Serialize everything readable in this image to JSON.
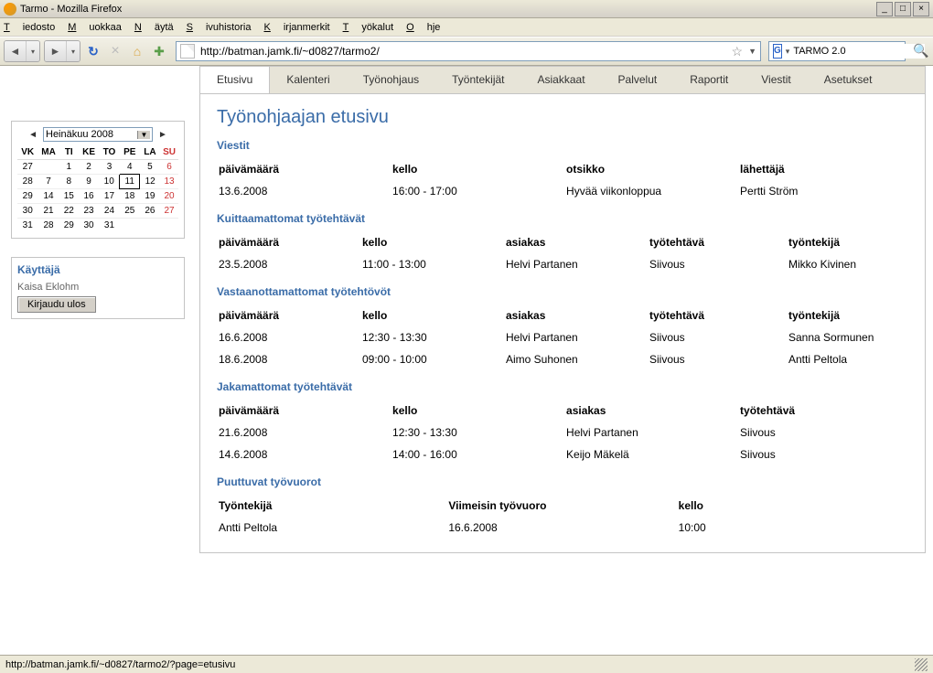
{
  "window": {
    "title": "Tarmo - Mozilla Firefox",
    "status": "http://batman.jamk.fi/~d0827/tarmo2/?page=etusivu"
  },
  "menubar": [
    "Tiedosto",
    "Muokkaa",
    "Näytä",
    "Sivuhistoria",
    "Kirjanmerkit",
    "Työkalut",
    "Ohje"
  ],
  "toolbar": {
    "url": "http://batman.jamk.fi/~d0827/tarmo2/",
    "search_value": "TARMO 2.0"
  },
  "calendar": {
    "month_label": "Heinäkuu 2008",
    "headers": [
      "VK",
      "MA",
      "TI",
      "KE",
      "TO",
      "PE",
      "LA",
      "SU"
    ],
    "rows": [
      [
        "27",
        "",
        "1",
        "2",
        "3",
        "4",
        "5",
        "6"
      ],
      [
        "28",
        "7",
        "8",
        "9",
        "10",
        "11",
        "12",
        "13"
      ],
      [
        "29",
        "14",
        "15",
        "16",
        "17",
        "18",
        "19",
        "20"
      ],
      [
        "30",
        "21",
        "22",
        "23",
        "24",
        "25",
        "26",
        "27"
      ],
      [
        "31",
        "28",
        "29",
        "30",
        "31",
        "",
        "",
        ""
      ]
    ],
    "today_cell": [
      1,
      5
    ]
  },
  "user": {
    "heading": "Käyttäjä",
    "name": "Kaisa Eklohm",
    "logout": "Kirjaudu ulos"
  },
  "tabs": [
    "Etusivu",
    "Kalenteri",
    "Työnohjaus",
    "Työntekijät",
    "Asiakkaat",
    "Palvelut",
    "Raportit",
    "Viestit",
    "Asetukset"
  ],
  "active_tab": 0,
  "page": {
    "title": "Työnohjaajan etusivu",
    "sections": {
      "viestit": {
        "title": "Viestit",
        "headers": [
          "päivämäärä",
          "kello",
          "otsikko",
          "lähettäjä"
        ],
        "rows": [
          [
            "13.6.2008",
            "16:00 - 17:00",
            "Hyvää viikonloppua",
            "Pertti Ström"
          ]
        ]
      },
      "kuittaamattomat": {
        "title": "Kuittaamattomat työtehtävät",
        "headers": [
          "päivämäärä",
          "kello",
          "asiakas",
          "työtehtävä",
          "työntekijä"
        ],
        "rows": [
          [
            "23.5.2008",
            "11:00 - 13:00",
            "Helvi Partanen",
            "Siivous",
            "Mikko Kivinen"
          ]
        ]
      },
      "vastaanottamattomat": {
        "title": "Vastaanottamattomat työtehtövöt",
        "headers": [
          "päivämäärä",
          "kello",
          "asiakas",
          "työtehtävä",
          "työntekijä"
        ],
        "rows": [
          [
            "16.6.2008",
            "12:30 - 13:30",
            "Helvi Partanen",
            "Siivous",
            "Sanna Sormunen"
          ],
          [
            "18.6.2008",
            "09:00 - 10:00",
            "Aimo Suhonen",
            "Siivous",
            "Antti Peltola"
          ]
        ]
      },
      "jakamattomat": {
        "title": "Jakamattomat työtehtävät",
        "headers": [
          "päivämäärä",
          "kello",
          "asiakas",
          "työtehtävä"
        ],
        "rows": [
          [
            "21.6.2008",
            "12:30 - 13:30",
            "Helvi Partanen",
            "Siivous"
          ],
          [
            "14.6.2008",
            "14:00 - 16:00",
            "Keijo Mäkelä",
            "Siivous"
          ]
        ]
      },
      "puuttuvat": {
        "title": "Puuttuvat työvuorot",
        "headers": [
          "Työntekijä",
          "Viimeisin työvuoro",
          "kello"
        ],
        "rows": [
          [
            "Antti Peltola",
            "16.6.2008",
            "10:00"
          ]
        ]
      }
    }
  }
}
